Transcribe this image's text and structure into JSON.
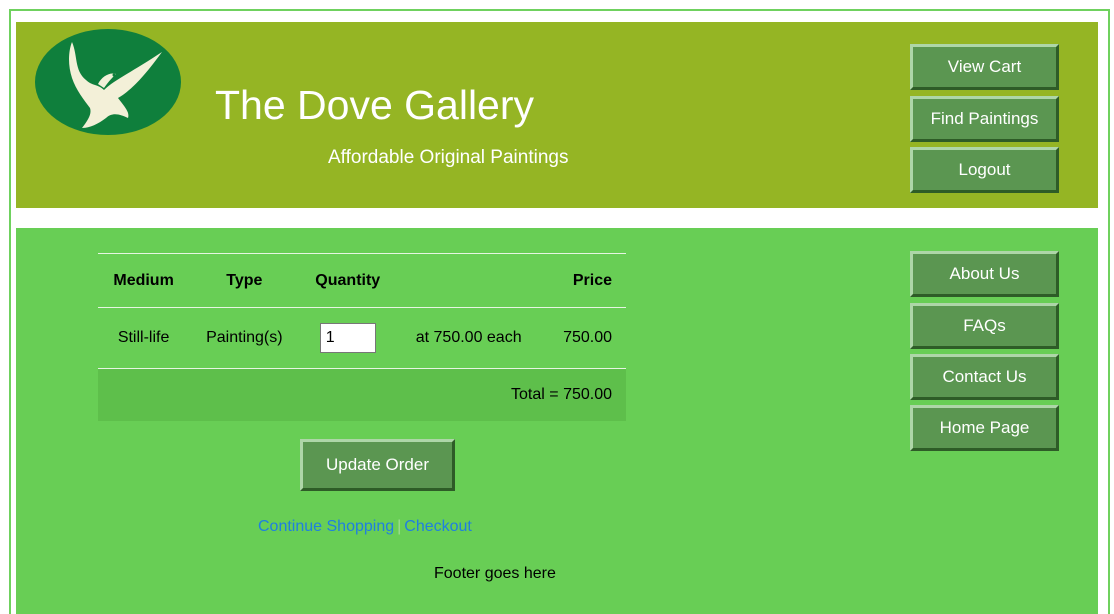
{
  "header": {
    "title": "The Dove Gallery",
    "tagline": "Affordable Original Paintings",
    "nav": [
      "View Cart",
      "Find Paintings",
      "Logout"
    ]
  },
  "sidebar": {
    "nav": [
      "About Us",
      "FAQs",
      "Contact Us",
      "Home Page"
    ]
  },
  "cart": {
    "headers": {
      "medium": "Medium",
      "type": "Type",
      "quantity": "Quantity",
      "price": "Price"
    },
    "row": {
      "medium": "Still-life",
      "type": "Painting(s)",
      "quantity": "1",
      "each": "at 750.00 each",
      "price": "750.00"
    },
    "total": "Total = 750.00"
  },
  "update_label": "Update Order",
  "links": {
    "continue": "Continue Shopping",
    "separator": "|",
    "checkout": "Checkout"
  },
  "footer": "Footer goes here",
  "colors": {
    "header_bg": "#95b524",
    "main_bg": "#68ce55",
    "button_bg": "#5b9651",
    "link": "#1f7fe0"
  }
}
